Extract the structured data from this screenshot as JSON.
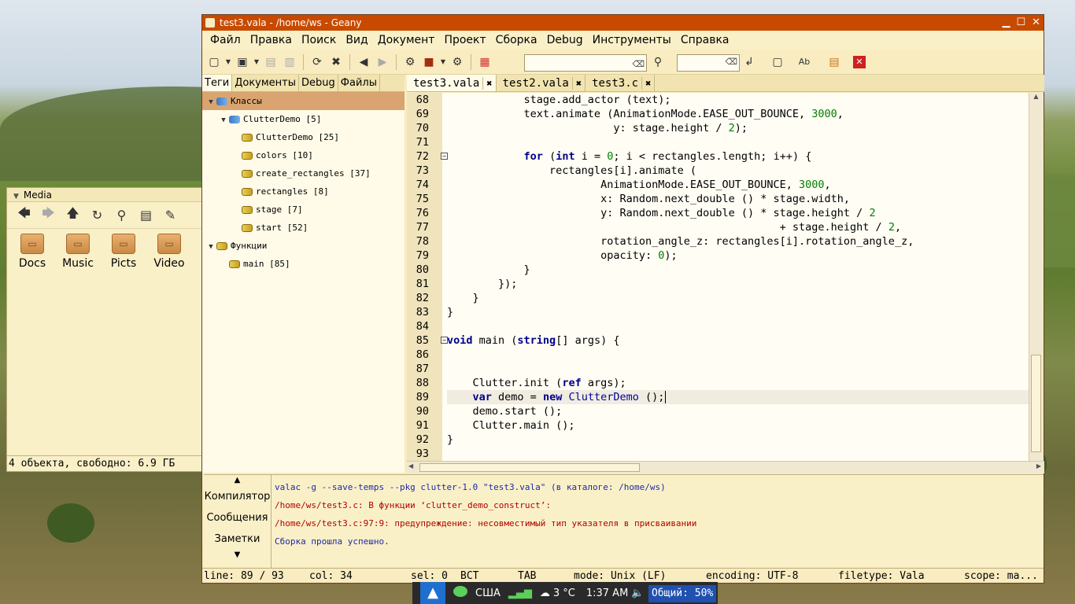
{
  "media": {
    "title": "Media",
    "folders": [
      "Docs",
      "Music",
      "Picts",
      "Video"
    ],
    "status": "4 объекта, свободно: 6.9 ГБ"
  },
  "geany": {
    "title": "test3.vala - /home/ws - Geany",
    "menu": [
      "Файл",
      "Правка",
      "Поиск",
      "Вид",
      "Документ",
      "Проект",
      "Сборка",
      "Debug",
      "Инструменты",
      "Справка"
    ],
    "sidebar_tabs": [
      "Теги",
      "Документы",
      "Debug",
      "Файлы"
    ],
    "symbols": [
      {
        "label": "Классы",
        "level": 0,
        "kind": "cls",
        "expander": "▼",
        "selected": true
      },
      {
        "label": "ClutterDemo [5]",
        "level": 1,
        "kind": "cls",
        "expander": "▼"
      },
      {
        "label": "ClutterDemo [25]",
        "level": 2,
        "kind": "mth"
      },
      {
        "label": "colors [10]",
        "level": 2,
        "kind": "mth"
      },
      {
        "label": "create_rectangles [37]",
        "level": 2,
        "kind": "mth"
      },
      {
        "label": "rectangles [8]",
        "level": 2,
        "kind": "mth"
      },
      {
        "label": "stage [7]",
        "level": 2,
        "kind": "mth"
      },
      {
        "label": "start [52]",
        "level": 2,
        "kind": "mth"
      },
      {
        "label": "Функции",
        "level": 0,
        "kind": "mth",
        "expander": "▼"
      },
      {
        "label": "main [85]",
        "level": 1,
        "kind": "mth"
      }
    ],
    "editor_tabs": [
      "test3.vala",
      "test2.vala",
      "test3.c"
    ],
    "code_lines": [
      {
        "n": "68",
        "html": "            stage.add_actor (text);"
      },
      {
        "n": "69",
        "html": "            text.animate (AnimationMode.EASE_OUT_BOUNCE, <span class='num'>3000</span>,"
      },
      {
        "n": "70",
        "html": "                          y: stage.height / <span class='num'>2</span>);"
      },
      {
        "n": "71",
        "html": ""
      },
      {
        "n": "72",
        "html": "            <span class='kw'>for</span> (<span class='kw'>int</span> i = <span class='num'>0</span>; i &lt; rectangles.length; i++) {",
        "fold": "-"
      },
      {
        "n": "73",
        "html": "                rectangles[i].animate ("
      },
      {
        "n": "74",
        "html": "                        AnimationMode.EASE_OUT_BOUNCE, <span class='num'>3000</span>,"
      },
      {
        "n": "75",
        "html": "                        x: Random.next_double () * stage.width,"
      },
      {
        "n": "76",
        "html": "                        y: Random.next_double () * stage.height / <span class='num'>2</span>"
      },
      {
        "n": "77",
        "html": "                                                    + stage.height / <span class='num'>2</span>,"
      },
      {
        "n": "78",
        "html": "                        rotation_angle_z: rectangles[i].rotation_angle_z,"
      },
      {
        "n": "79",
        "html": "                        opacity: <span class='num'>0</span>);"
      },
      {
        "n": "80",
        "html": "            }"
      },
      {
        "n": "81",
        "html": "        });"
      },
      {
        "n": "82",
        "html": "    }"
      },
      {
        "n": "83",
        "html": "}"
      },
      {
        "n": "84",
        "html": ""
      },
      {
        "n": "85",
        "html": "<span class='kw'>void</span> main (<span class='kw'>string</span>[] args) {",
        "fold": "-"
      },
      {
        "n": "86",
        "html": ""
      },
      {
        "n": "87",
        "html": ""
      },
      {
        "n": "88",
        "html": "    Clutter.init (<span class='kw'>ref</span> args);"
      },
      {
        "n": "89",
        "html": "    <span class='kw'>var</span> demo = <span class='kw'>new</span> <span class='typ'>ClutterDemo</span> ();|",
        "current": true
      },
      {
        "n": "90",
        "html": "    demo.start ();"
      },
      {
        "n": "91",
        "html": "    Clutter.main ();"
      },
      {
        "n": "92",
        "html": "}"
      },
      {
        "n": "93",
        "html": ""
      }
    ],
    "msg_tabs": [
      "Компилятор",
      "Сообщения",
      "Заметки"
    ],
    "messages": [
      {
        "text": "valac -g --save-temps --pkg clutter-1.0 \"test3.vala\" (в каталоге: /home/ws)",
        "color": "blue"
      },
      {
        "text": "/home/ws/test3.c: В функции ‘clutter_demo_construct’:",
        "color": "red"
      },
      {
        "text": "/home/ws/test3.c:97:9: предупреждение: несовместимый тип указателя в присваивании",
        "color": "red"
      },
      {
        "text": "Сборка прошла успешно.",
        "color": "blue"
      }
    ],
    "status": {
      "line": "line: 89 / 93",
      "col": "col: 34",
      "sel": "sel: 0",
      "ins": "ВСТ",
      "tab": "TAB",
      "mode": "mode: Unix (LF)",
      "encoding": "encoding: UTF-8",
      "filetype": "filetype: Vala",
      "scope": "scope: ma..."
    }
  },
  "panel": {
    "layout": "США",
    "temp": "3 °C",
    "time": "1:37 AM",
    "battery": "Общий: 50%"
  }
}
